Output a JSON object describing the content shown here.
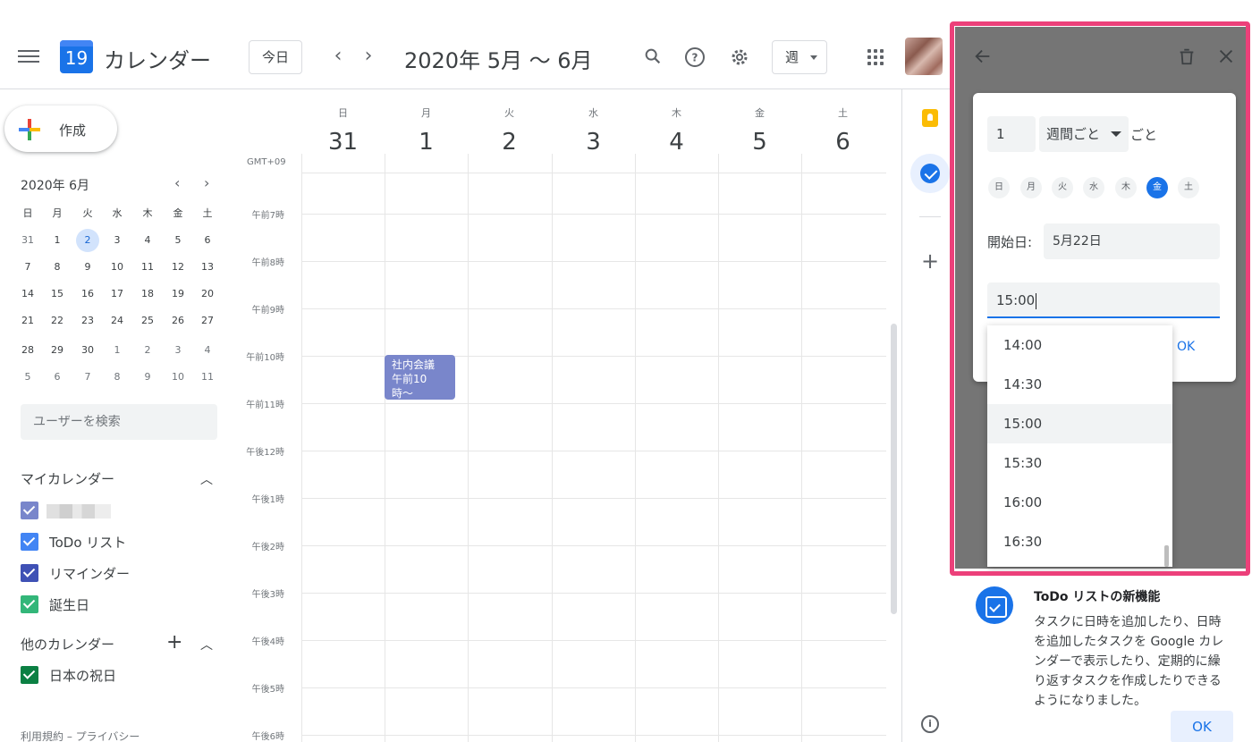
{
  "header": {
    "app_title": "カレンダー",
    "logo_day": "19",
    "today_label": "今日",
    "date_range": "2020年 5月 〜 6月",
    "view_label": "週"
  },
  "sidebar": {
    "create_label": "作成",
    "mini_month_title": "2020年 6月",
    "mini_dow": [
      "日",
      "月",
      "火",
      "水",
      "木",
      "金",
      "土"
    ],
    "mini_weeks": [
      [
        "31",
        "1",
        "2",
        "3",
        "4",
        "5",
        "6"
      ],
      [
        "7",
        "8",
        "9",
        "10",
        "11",
        "12",
        "13"
      ],
      [
        "14",
        "15",
        "16",
        "17",
        "18",
        "19",
        "20"
      ],
      [
        "21",
        "22",
        "23",
        "24",
        "25",
        "26",
        "27"
      ],
      [
        "28",
        "29",
        "30",
        "1",
        "2",
        "3",
        "4"
      ],
      [
        "5",
        "6",
        "7",
        "8",
        "9",
        "10",
        "11"
      ]
    ],
    "search_users_placeholder": "ユーザーを検索",
    "my_calendars_title": "マイカレンダー",
    "my_calendars": [
      {
        "label": "",
        "color": "#7986cb"
      },
      {
        "label": "ToDo リスト",
        "color": "#4285f4"
      },
      {
        "label": "リマインダー",
        "color": "#3f51b5"
      },
      {
        "label": "誕生日",
        "color": "#33b679"
      }
    ],
    "other_calendars_title": "他のカレンダー",
    "other_calendars": [
      {
        "label": "日本の祝日",
        "color": "#0b8043"
      }
    ],
    "footer": "利用規約 – プライバシー"
  },
  "week": {
    "days": [
      {
        "dow": "日",
        "num": "31"
      },
      {
        "dow": "月",
        "num": "1"
      },
      {
        "dow": "火",
        "num": "2"
      },
      {
        "dow": "水",
        "num": "3"
      },
      {
        "dow": "木",
        "num": "4"
      },
      {
        "dow": "金",
        "num": "5"
      },
      {
        "dow": "土",
        "num": "6"
      }
    ],
    "timezone": "GMT+09",
    "times": [
      "午前7時",
      "午前8時",
      "午前9時",
      "午前10時",
      "午前11時",
      "午後12時",
      "午後1時",
      "午後2時",
      "午後3時",
      "午後4時",
      "午後5時",
      "午後6時"
    ],
    "event": {
      "title": "社内会議",
      "time": "午前10時〜"
    }
  },
  "task_repeat": {
    "interval": "1",
    "unit": "週間ごと",
    "suffix": "ごと",
    "weekdays": [
      "日",
      "月",
      "火",
      "水",
      "木",
      "金",
      "土"
    ],
    "selected_weekday": "金",
    "start_label": "開始日:",
    "start_value": "5月22日",
    "time_value": "15:00",
    "ok_label": "OK",
    "time_options": [
      "14:00",
      "14:30",
      "15:00",
      "15:30",
      "16:00",
      "16:30"
    ],
    "hovered_time": "15:00"
  },
  "tip": {
    "title": "ToDo リストの新機能",
    "body": "タスクに日時を追加したり、日時を追加したタスクを Google カレンダーで表示したり、定期的に繰り返すタスクを作成したりできるようになりました。",
    "ok_label": "OK"
  }
}
